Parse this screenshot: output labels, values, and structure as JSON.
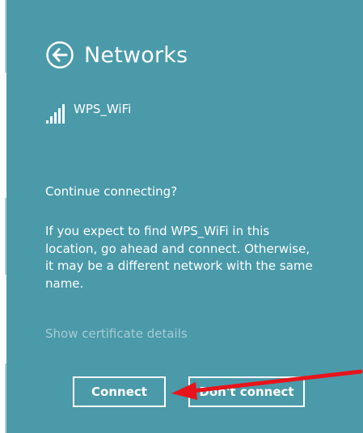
{
  "header": {
    "title": "Networks",
    "back_icon": "back-arrow-circle-icon"
  },
  "network": {
    "name": "WPS_WiFi",
    "signal_icon": "wifi-signal-bars-icon"
  },
  "prompt": {
    "question": "Continue connecting?",
    "message": "If you expect to find WPS_WiFi in this location, go ahead and connect. Otherwise, it may be a different network with the same name.",
    "certificate_link": "Show certificate details"
  },
  "buttons": {
    "connect_label": "Connect",
    "dont_connect_label": "Don't connect"
  },
  "annotation": {
    "arrow_color": "#e8141b",
    "points_to": "connect-button"
  },
  "colors": {
    "panel_background": "#4a9aaa",
    "text": "#ffffff",
    "muted_link": "#a8ccd3"
  }
}
